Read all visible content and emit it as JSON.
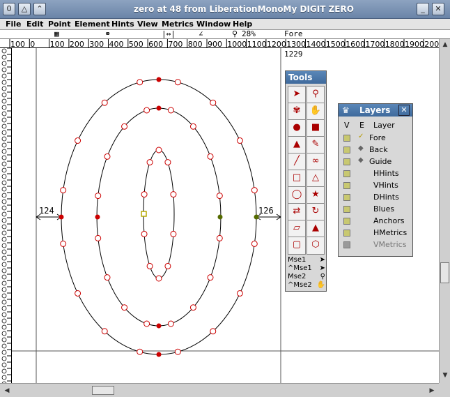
{
  "window": {
    "title": "zero at 48 from LiberationMonoMy DIGIT ZERO",
    "left_button": "0"
  },
  "menu": [
    {
      "label": "File",
      "key": "F"
    },
    {
      "label": "Edit",
      "key": "E"
    },
    {
      "label": "Point",
      "key": "P"
    },
    {
      "label": "Element",
      "key": "l"
    },
    {
      "label": "Hints",
      "key": "H"
    },
    {
      "label": "View",
      "key": "V"
    },
    {
      "label": "Metrics",
      "key": "M"
    },
    {
      "label": "Window",
      "key": "W"
    },
    {
      "label": "Help",
      "key": "H"
    }
  ],
  "infobar": {
    "zoom": "28%",
    "layer": "Fore"
  },
  "ruler": {
    "ticks": [
      "100",
      "0",
      "100",
      "200",
      "300",
      "400",
      "500",
      "600",
      "700",
      "800",
      "900",
      "1000",
      "1100",
      "1200",
      "1300",
      "1400",
      "1500",
      "1600",
      "1700",
      "1800",
      "1900",
      "200"
    ]
  },
  "canvas": {
    "width_readout": "1229",
    "left_bearing": "124",
    "right_bearing": "126"
  },
  "tools_palette": {
    "title": "Tools",
    "tools": [
      "pointer-tool",
      "magnify-tool",
      "freehand-tool",
      "scroll-tool",
      "curve-point-tool",
      "corner-point-tool",
      "tangent-point-tool",
      "pen-tool",
      "ruler-tool",
      "knife-tool",
      "rectangle-tool",
      "polygon-tool",
      "ellipse-tool",
      "star-tool",
      "flip-tool",
      "rotate-tool",
      "skew-tool",
      "perspective-tool",
      "scale-tool",
      "hexagon-tool"
    ],
    "mouse": [
      {
        "label": "Mse1",
        "icon": "pointer-icon"
      },
      {
        "label": "^Mse1",
        "icon": "pointer-icon"
      },
      {
        "label": "Mse2",
        "icon": "magnify-icon"
      },
      {
        "label": "^Mse2",
        "icon": "scroll-icon"
      }
    ]
  },
  "layers_palette": {
    "title": "Layers",
    "header": {
      "v": "V",
      "e": "E",
      "layer": "Layer"
    },
    "layers": [
      {
        "name": "Fore",
        "visible": true,
        "editable_mark": "check"
      },
      {
        "name": "Back",
        "visible": true,
        "editable_mark": "diamond"
      },
      {
        "name": "Guide",
        "visible": true,
        "editable_mark": "diamond"
      },
      {
        "name": "HHints",
        "visible": true
      },
      {
        "name": "VHints",
        "visible": true
      },
      {
        "name": "DHints",
        "visible": true
      },
      {
        "name": "Blues",
        "visible": true
      },
      {
        "name": "Anchors",
        "visible": true
      },
      {
        "name": "HMetrics",
        "visible": true
      },
      {
        "name": "VMetrics",
        "visible": false
      }
    ]
  },
  "colors": {
    "titlebar": "#6a84a8",
    "palette_title": "#3f6a9c",
    "point_red": "#cc0000",
    "point_olive": "#556b00"
  }
}
